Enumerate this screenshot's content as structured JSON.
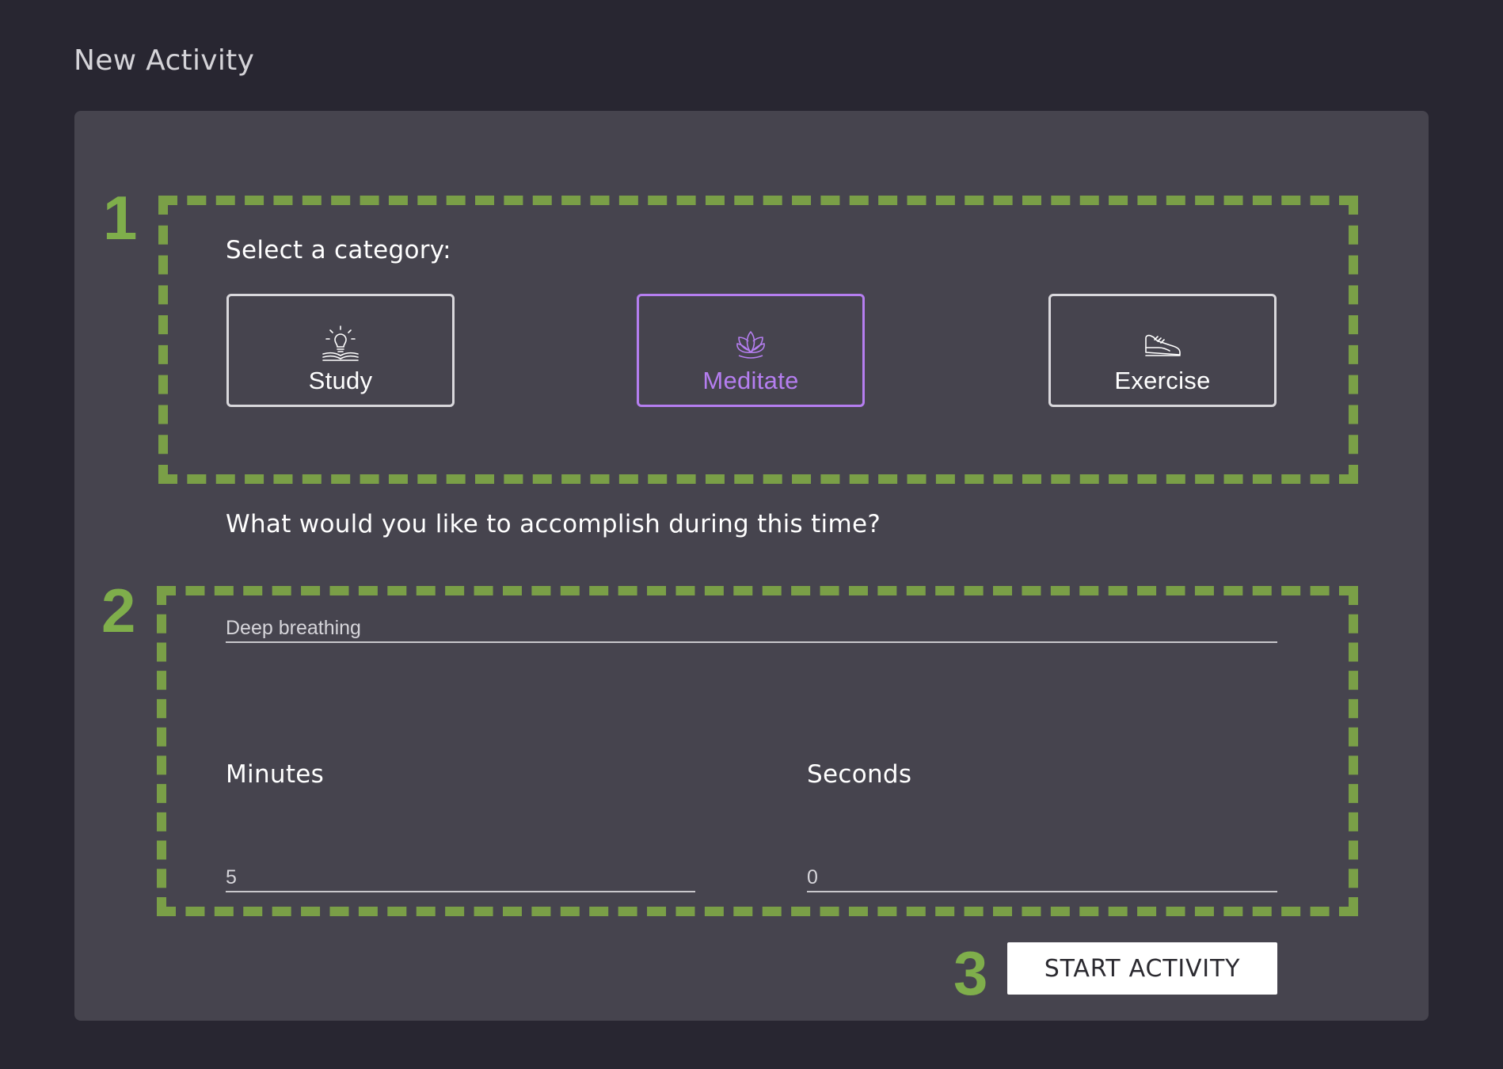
{
  "page": {
    "title": "New Activity"
  },
  "annotations": [
    "1",
    "2",
    "3"
  ],
  "category_section": {
    "label": "Select a category:",
    "selected": "Meditate",
    "options": [
      {
        "label": "Study",
        "icon": "lightbulb-book-icon",
        "selected": false
      },
      {
        "label": "Meditate",
        "icon": "lotus-icon",
        "selected": true
      },
      {
        "label": "Exercise",
        "icon": "sneaker-icon",
        "selected": false
      }
    ]
  },
  "goal": {
    "label": "What would you like to accomplish during this time?",
    "value": "Deep breathing"
  },
  "duration": {
    "minutes_label": "Minutes",
    "minutes_value": "5",
    "seconds_label": "Seconds",
    "seconds_value": "0"
  },
  "actions": {
    "start_label": "START ACTIVITY"
  },
  "colors": {
    "background": "#282631",
    "card": "#46444e",
    "annotation_green": "#7a9f47",
    "selected_accent": "#b57ef0",
    "text": "#ffffff"
  }
}
